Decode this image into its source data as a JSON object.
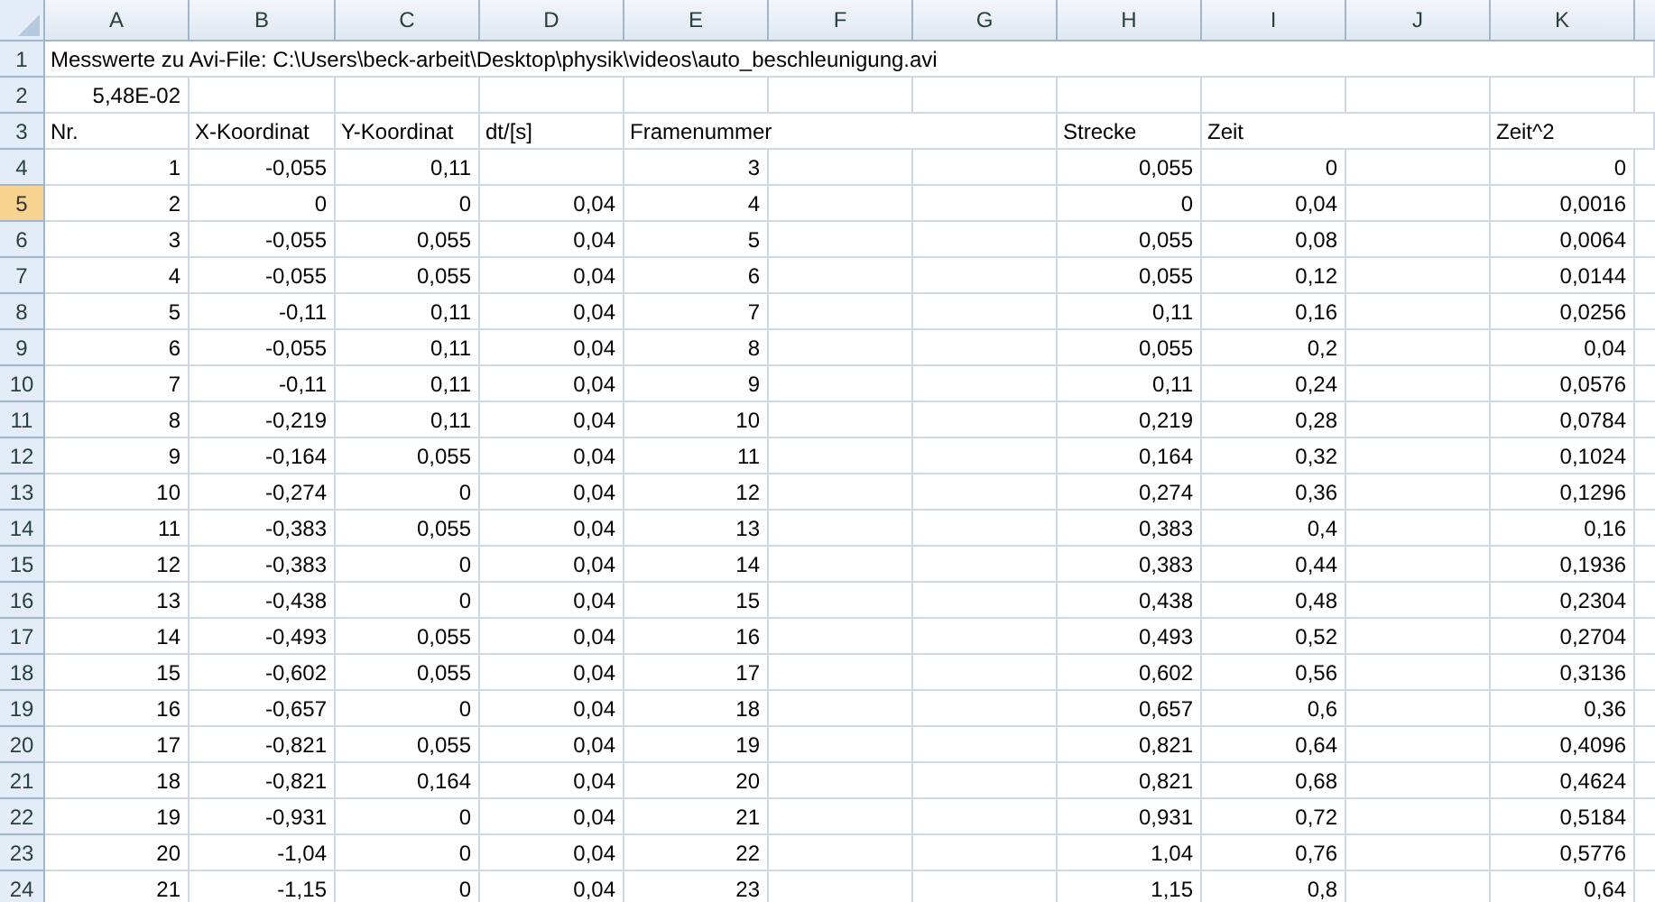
{
  "columns": [
    {
      "label": "A"
    },
    {
      "label": "B"
    },
    {
      "label": "C"
    },
    {
      "label": "D"
    },
    {
      "label": "E"
    },
    {
      "label": "F"
    },
    {
      "label": "G"
    },
    {
      "label": "H"
    },
    {
      "label": "I"
    },
    {
      "label": "J"
    },
    {
      "label": "K"
    }
  ],
  "rows": [
    {
      "number": "1",
      "selected": false,
      "kind": "label",
      "cells": {
        "A": "Messwerte zu Avi-File: C:\\Users\\beck-arbeit\\Desktop\\physik\\videos\\auto_beschleunigung.avi"
      }
    },
    {
      "number": "2",
      "selected": false,
      "kind": "values",
      "cells": {
        "A": "5,48E-02"
      }
    },
    {
      "number": "3",
      "selected": false,
      "kind": "label",
      "cells": {
        "A": "Nr.",
        "B": "X-Koordinat",
        "C": "Y-Koordinat",
        "D": "dt/[s]",
        "E": "Framenummer",
        "H": "Strecke",
        "I": "Zeit",
        "K": "Zeit^2"
      }
    },
    {
      "number": "4",
      "selected": false,
      "kind": "values",
      "cells": {
        "A": "1",
        "B": "-0,055",
        "C": "0,11",
        "E": "3",
        "H": "0,055",
        "I": "0",
        "K": "0"
      }
    },
    {
      "number": "5",
      "selected": true,
      "kind": "values",
      "cells": {
        "A": "2",
        "B": "0",
        "C": "0",
        "D": "0,04",
        "E": "4",
        "H": "0",
        "I": "0,04",
        "K": "0,0016"
      }
    },
    {
      "number": "6",
      "selected": false,
      "kind": "values",
      "cells": {
        "A": "3",
        "B": "-0,055",
        "C": "0,055",
        "D": "0,04",
        "E": "5",
        "H": "0,055",
        "I": "0,08",
        "K": "0,0064"
      }
    },
    {
      "number": "7",
      "selected": false,
      "kind": "values",
      "cells": {
        "A": "4",
        "B": "-0,055",
        "C": "0,055",
        "D": "0,04",
        "E": "6",
        "H": "0,055",
        "I": "0,12",
        "K": "0,0144"
      }
    },
    {
      "number": "8",
      "selected": false,
      "kind": "values",
      "cells": {
        "A": "5",
        "B": "-0,11",
        "C": "0,11",
        "D": "0,04",
        "E": "7",
        "H": "0,11",
        "I": "0,16",
        "K": "0,0256"
      }
    },
    {
      "number": "9",
      "selected": false,
      "kind": "values",
      "cells": {
        "A": "6",
        "B": "-0,055",
        "C": "0,11",
        "D": "0,04",
        "E": "8",
        "H": "0,055",
        "I": "0,2",
        "K": "0,04"
      }
    },
    {
      "number": "10",
      "selected": false,
      "kind": "values",
      "cells": {
        "A": "7",
        "B": "-0,11",
        "C": "0,11",
        "D": "0,04",
        "E": "9",
        "H": "0,11",
        "I": "0,24",
        "K": "0,0576"
      }
    },
    {
      "number": "11",
      "selected": false,
      "kind": "values",
      "cells": {
        "A": "8",
        "B": "-0,219",
        "C": "0,11",
        "D": "0,04",
        "E": "10",
        "H": "0,219",
        "I": "0,28",
        "K": "0,0784"
      }
    },
    {
      "number": "12",
      "selected": false,
      "kind": "values",
      "cells": {
        "A": "9",
        "B": "-0,164",
        "C": "0,055",
        "D": "0,04",
        "E": "11",
        "H": "0,164",
        "I": "0,32",
        "K": "0,1024"
      }
    },
    {
      "number": "13",
      "selected": false,
      "kind": "values",
      "cells": {
        "A": "10",
        "B": "-0,274",
        "C": "0",
        "D": "0,04",
        "E": "12",
        "H": "0,274",
        "I": "0,36",
        "K": "0,1296"
      }
    },
    {
      "number": "14",
      "selected": false,
      "kind": "values",
      "cells": {
        "A": "11",
        "B": "-0,383",
        "C": "0,055",
        "D": "0,04",
        "E": "13",
        "H": "0,383",
        "I": "0,4",
        "K": "0,16"
      }
    },
    {
      "number": "15",
      "selected": false,
      "kind": "values",
      "cells": {
        "A": "12",
        "B": "-0,383",
        "C": "0",
        "D": "0,04",
        "E": "14",
        "H": "0,383",
        "I": "0,44",
        "K": "0,1936"
      }
    },
    {
      "number": "16",
      "selected": false,
      "kind": "values",
      "cells": {
        "A": "13",
        "B": "-0,438",
        "C": "0",
        "D": "0,04",
        "E": "15",
        "H": "0,438",
        "I": "0,48",
        "K": "0,2304"
      }
    },
    {
      "number": "17",
      "selected": false,
      "kind": "values",
      "cells": {
        "A": "14",
        "B": "-0,493",
        "C": "0,055",
        "D": "0,04",
        "E": "16",
        "H": "0,493",
        "I": "0,52",
        "K": "0,2704"
      }
    },
    {
      "number": "18",
      "selected": false,
      "kind": "values",
      "cells": {
        "A": "15",
        "B": "-0,602",
        "C": "0,055",
        "D": "0,04",
        "E": "17",
        "H": "0,602",
        "I": "0,56",
        "K": "0,3136"
      }
    },
    {
      "number": "19",
      "selected": false,
      "kind": "values",
      "cells": {
        "A": "16",
        "B": "-0,657",
        "C": "0",
        "D": "0,04",
        "E": "18",
        "H": "0,657",
        "I": "0,6",
        "K": "0,36"
      }
    },
    {
      "number": "20",
      "selected": false,
      "kind": "values",
      "cells": {
        "A": "17",
        "B": "-0,821",
        "C": "0,055",
        "D": "0,04",
        "E": "19",
        "H": "0,821",
        "I": "0,64",
        "K": "0,4096"
      }
    },
    {
      "number": "21",
      "selected": false,
      "kind": "values",
      "cells": {
        "A": "18",
        "B": "-0,821",
        "C": "0,164",
        "D": "0,04",
        "E": "20",
        "H": "0,821",
        "I": "0,68",
        "K": "0,4624"
      }
    },
    {
      "number": "22",
      "selected": false,
      "kind": "values",
      "cells": {
        "A": "19",
        "B": "-0,931",
        "C": "0",
        "D": "0,04",
        "E": "21",
        "H": "0,931",
        "I": "0,72",
        "K": "0,5184"
      }
    },
    {
      "number": "23",
      "selected": false,
      "kind": "values",
      "cells": {
        "A": "20",
        "B": "-1,04",
        "C": "0",
        "D": "0,04",
        "E": "22",
        "H": "1,04",
        "I": "0,76",
        "K": "0,5776"
      }
    },
    {
      "number": "24",
      "selected": false,
      "kind": "values",
      "cells": {
        "A": "21",
        "B": "-1,15",
        "C": "0",
        "D": "0,04",
        "E": "23",
        "H": "1,15",
        "I": "0,8",
        "K": "0,64"
      }
    }
  ]
}
